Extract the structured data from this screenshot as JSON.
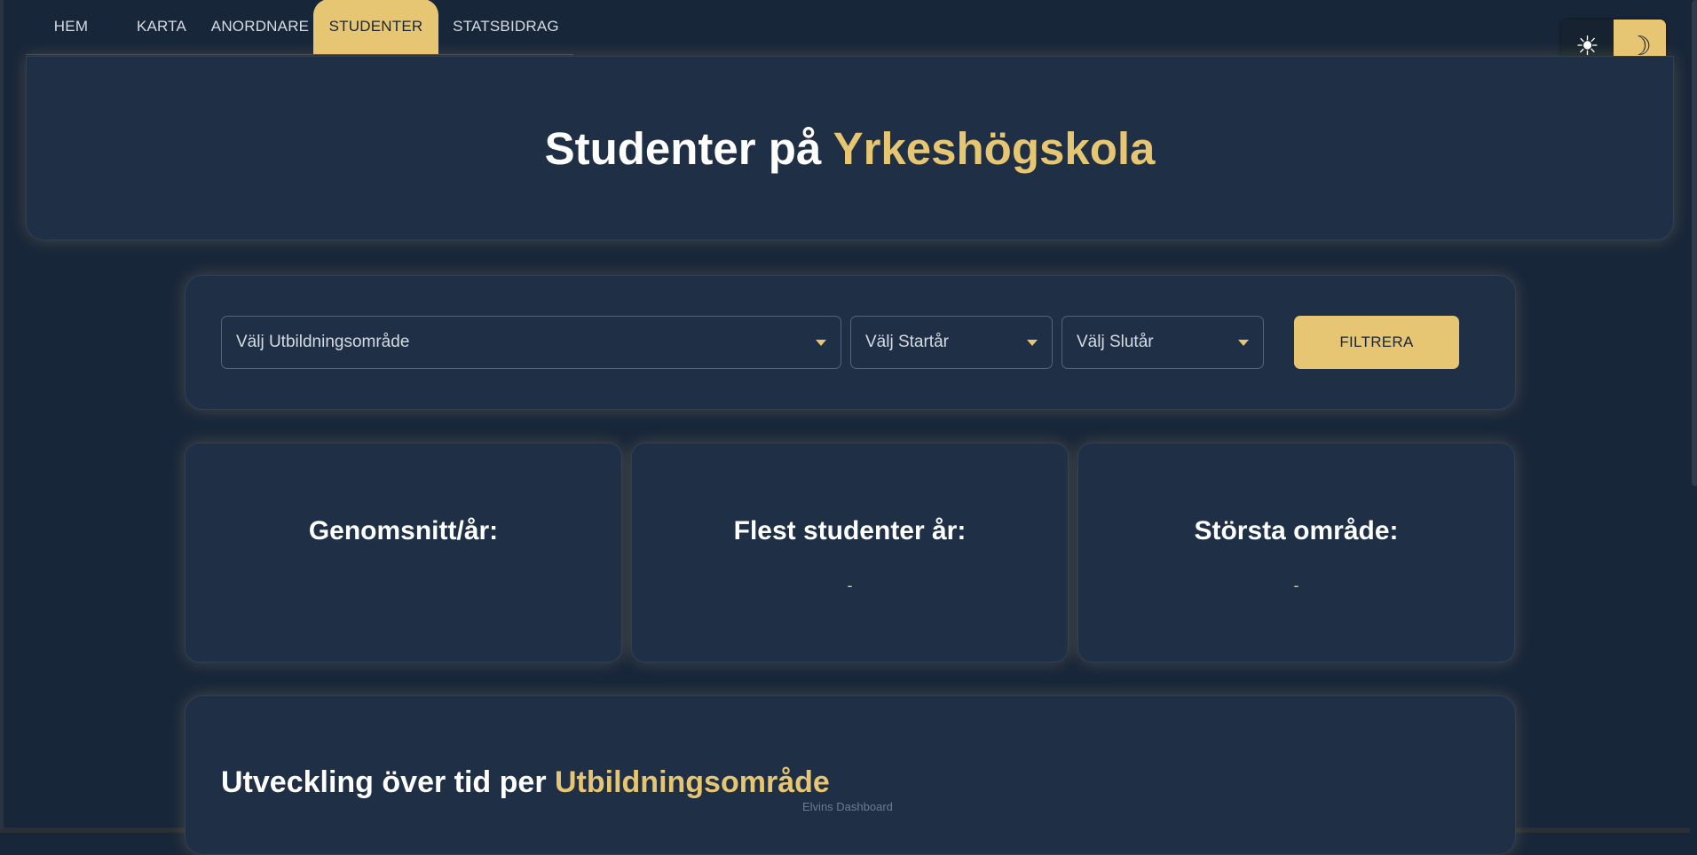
{
  "nav": {
    "tabs": [
      {
        "label": "HEM",
        "active": false
      },
      {
        "label": "KARTA",
        "active": false
      },
      {
        "label": "ANORDNARE",
        "active": false
      },
      {
        "label": "STUDENTER",
        "active": true
      },
      {
        "label": "STATSBIDRAG",
        "active": false
      }
    ]
  },
  "theme_toggle": {
    "light_icon": "sun-icon",
    "dark_icon": "moon-icon",
    "light_glyph": "☀",
    "dark_glyph": "☽",
    "selected": "dark"
  },
  "header": {
    "title_prefix": "Studenter på",
    "title_accent": "Yrkeshögskola"
  },
  "filters": {
    "area_placeholder": "Välj Utbildningsområde",
    "start_year_placeholder": "Välj Startår",
    "end_year_placeholder": "Välj Slutår",
    "filter_button_label": "FILTRERA"
  },
  "stats": [
    {
      "label": "Genomsnitt/år:",
      "value": ""
    },
    {
      "label": "Flest studenter år:",
      "value": "-"
    },
    {
      "label": "Största område:",
      "value": "-"
    }
  ],
  "chart_section": {
    "title_prefix": "Utveckling över tid per",
    "title_accent": "Utbildningsområde"
  },
  "footer": {
    "text": "Elvins Dashboard"
  },
  "colors": {
    "background": "#18263a",
    "card": "#1f2f45",
    "accent": "#e7c673",
    "text": "#ffffff"
  }
}
